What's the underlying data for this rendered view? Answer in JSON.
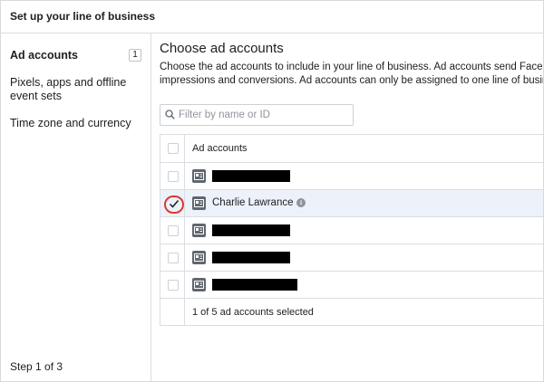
{
  "header": {
    "title": "Set up your line of business"
  },
  "sidebar": {
    "items": [
      {
        "label": "Ad accounts",
        "badge": "1"
      },
      {
        "label_line1": "Pixels, apps and offline",
        "label_line2": "event sets"
      },
      {
        "label": "Time zone and currency"
      }
    ],
    "step": "Step 1 of 3"
  },
  "main": {
    "title": "Choose ad accounts",
    "desc_line1": "Choose the ad accounts to include in your line of business. Ad accounts send Facebook",
    "desc_line2": "impressions and conversions. Ad accounts can only be assigned to one line of business.",
    "search": {
      "placeholder": "Filter by name or ID",
      "value": ""
    },
    "table": {
      "column_header": "Ad accounts",
      "rows": [
        {
          "name": "",
          "selected": false,
          "redacted": true
        },
        {
          "name": "Charlie Lawrance",
          "selected": true,
          "redacted": false
        },
        {
          "name": "",
          "selected": false,
          "redacted": true
        },
        {
          "name": "",
          "selected": false,
          "redacted": true
        },
        {
          "name": "",
          "selected": false,
          "redacted": true
        }
      ],
      "footer": "1 of 5 ad accounts selected"
    }
  },
  "colors": {
    "accent_ring": "#d93a35",
    "selected_row": "#edf2fa",
    "icon_gray": "#606770"
  },
  "icons": [
    "search-icon",
    "checkmark-icon",
    "ad-account-icon",
    "info-icon"
  ]
}
